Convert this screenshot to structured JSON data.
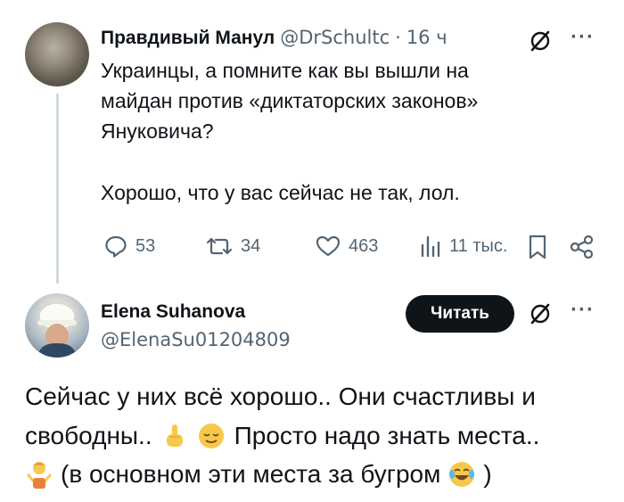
{
  "tweet1": {
    "author_name": "Правдивый Манул",
    "handle": "@DrSchultc",
    "separator": "·",
    "time": "16 ч",
    "text_lines": [
      "Украинцы, а помните как вы вышли на",
      "майдан против «диктаторских законов»",
      "Януковича?",
      "Хорошо, что у вас сейчас не так, лол."
    ],
    "replies": "53",
    "reposts": "34",
    "likes": "463",
    "views": "11 тыс."
  },
  "tweet2": {
    "author_name": "Elena Suhanova",
    "handle": "@ElenaSu01204809",
    "follow_label": "Читать",
    "line1": "Сейчас у них всё хорошо.. Они счастливы и",
    "line2a": "свободны..",
    "line2b": "Просто надо знать места..",
    "line3": "(в основном эти места за бугром",
    "line3_end": ")"
  },
  "icons": {
    "grok": "grok-icon",
    "more": "more-icon",
    "reply": "reply-icon",
    "repost": "repost-icon",
    "like": "heart-icon",
    "views": "views-icon",
    "bookmark": "bookmark-icon",
    "share": "share-icon",
    "emoji1": "pointing-up-emoji",
    "emoji2": "relieved-face-emoji",
    "emoji3": "person-shrugging-emoji",
    "emoji4": "tears-of-joy-emoji"
  },
  "colors": {
    "text": "#0f1419",
    "secondary": "#536471",
    "button_bg": "#0f1419",
    "thread_line": "#cfd9de"
  }
}
